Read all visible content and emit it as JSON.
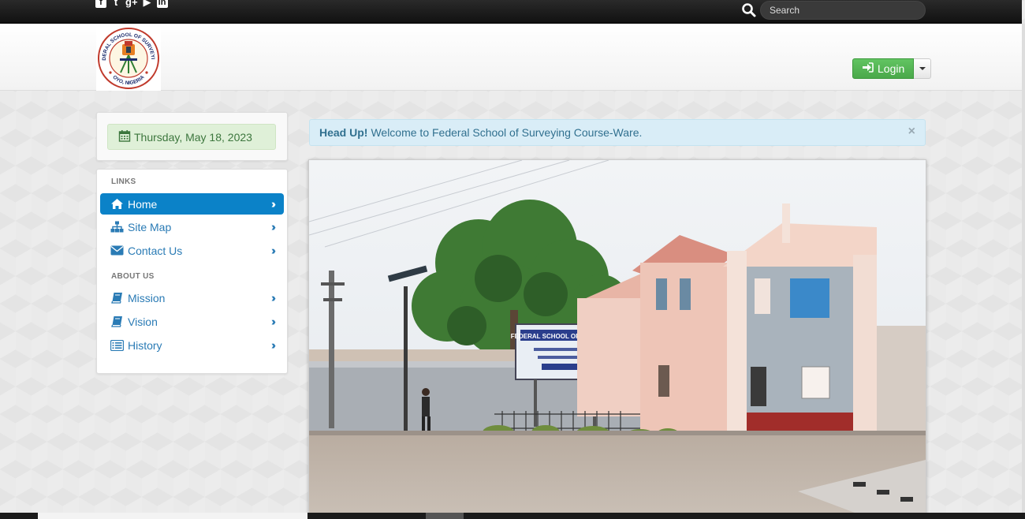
{
  "topbar": {
    "social_icons": [
      "facebook-icon",
      "twitter-icon",
      "google-plus-icon",
      "youtube-icon",
      "linkedin-icon"
    ],
    "social_glyphs": {
      "facebook": "f",
      "twitter": "t",
      "google_plus": "g+",
      "youtube": "▶",
      "linkedin": "in"
    },
    "search_placeholder": "Search"
  },
  "header": {
    "logo_top_text": "FEDERAL SCHOOL OF SURVEYING",
    "logo_bottom_text": "OYO, NIGERIA",
    "login_label": "Login"
  },
  "sidebar": {
    "date": "Thursday, May 18, 2023",
    "sections": [
      {
        "header": "LINKS",
        "items": [
          {
            "label": "Home",
            "icon": "home-icon",
            "active": true
          },
          {
            "label": "Site Map",
            "icon": "sitemap-icon"
          },
          {
            "label": "Contact Us",
            "icon": "envelope-icon"
          }
        ]
      },
      {
        "header": "ABOUT US",
        "items": [
          {
            "label": "Mission",
            "icon": "book-icon"
          },
          {
            "label": "Vision",
            "icon": "book-icon"
          },
          {
            "label": "History",
            "icon": "list-icon"
          }
        ]
      }
    ]
  },
  "alert": {
    "title": "Head Up!",
    "message": "Welcome to Federal School of Surveying Course-Ware.",
    "close": "×"
  },
  "photo": {
    "sign_text": "FEDERAL SCHOOL OF SURVEYING"
  },
  "colors": {
    "primary": "#0b82c8",
    "success": "#5cb85c",
    "info_bg": "#d9edf7",
    "date_bg": "#dff0d8",
    "topbar": "#1a1a1a"
  }
}
